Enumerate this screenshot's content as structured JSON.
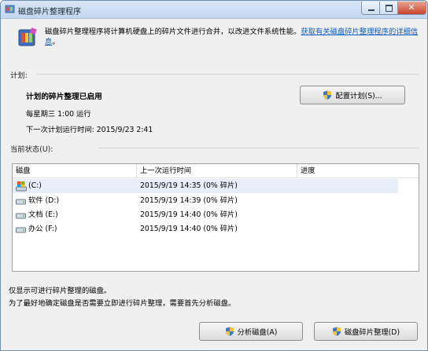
{
  "window": {
    "title": "磁盘碎片整理程序"
  },
  "header": {
    "text": "磁盘碎片整理程序将计算机硬盘上的碎片文件进行合并，以改进文件系统性能。",
    "link": "获取有关磁盘碎片整理程序的详细信息",
    "link_end": "。"
  },
  "schedule": {
    "section_label": "计划:",
    "status": "计划的碎片整理已启用",
    "frequency": "每星期三  1:00 运行",
    "next_run": "下一次计划运行时间: 2015/9/23 2:41",
    "configure_button": "配置计划(S)..."
  },
  "current_status": {
    "section_label": "当前状态(U):",
    "columns": [
      "磁盘",
      "上一次运行时间",
      "进度"
    ],
    "rows": [
      {
        "disk": "(C:)",
        "last_run": "2015/9/19 14:35 (0% 碎片)",
        "progress": "",
        "icon": "system-drive-icon"
      },
      {
        "disk": "软件 (D:)",
        "last_run": "2015/9/19 14:39 (0% 碎片)",
        "progress": "",
        "icon": "drive-icon"
      },
      {
        "disk": "文档 (E:)",
        "last_run": "2015/9/19 14:40 (0% 碎片)",
        "progress": "",
        "icon": "drive-icon"
      },
      {
        "disk": "办公 (F:)",
        "last_run": "2015/9/19 14:40 (0% 碎片)",
        "progress": "",
        "icon": "drive-icon"
      }
    ]
  },
  "notes": {
    "line1": "仅显示可进行碎片整理的磁盘。",
    "line2": "为了最好地确定磁盘是否需要立即进行碎片整理，需要首先分析磁盘。"
  },
  "buttons": {
    "analyze": "分析磁盘(A)",
    "defrag": "磁盘碎片整理(D)"
  },
  "colors": {
    "link": "#0b5cc4",
    "title_bar": "#c2d8ef",
    "close_button": "#c8442a"
  }
}
